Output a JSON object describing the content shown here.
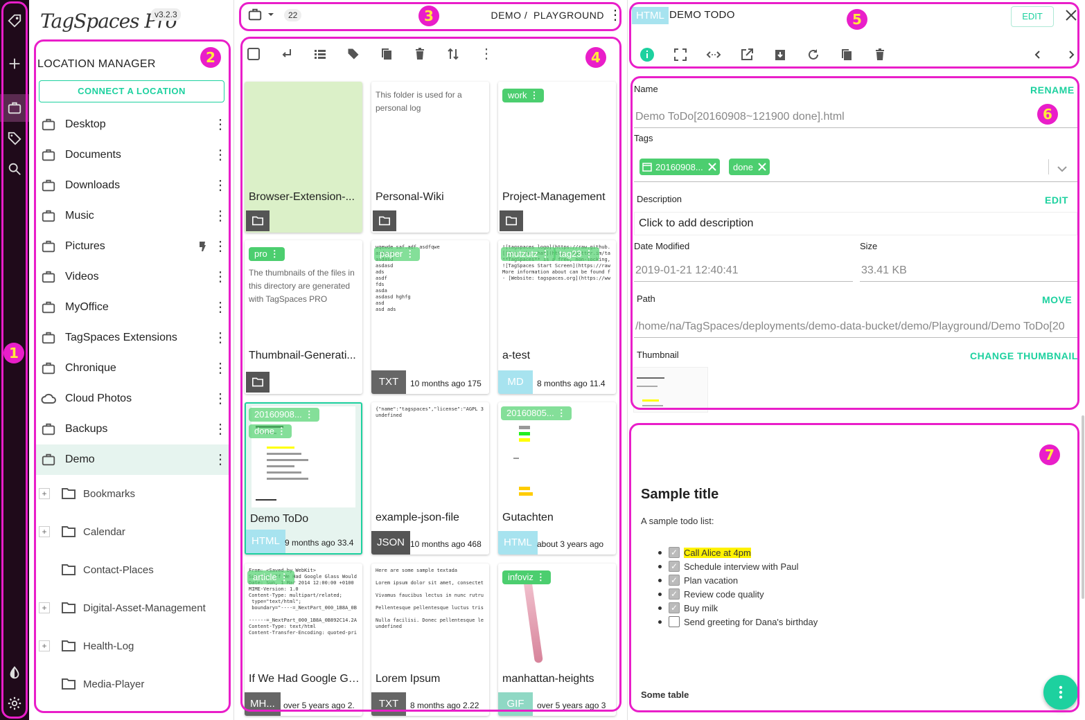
{
  "app": {
    "logo": "TagSpaces Pro",
    "version": "v3.2.3"
  },
  "leftbar": {
    "icons": [
      "tagspaces-logo-icon",
      "add-icon",
      "locations-icon",
      "tags-icon",
      "search-icon",
      "theme-icon",
      "settings-icon"
    ]
  },
  "location_manager": {
    "title": "LOCATION MANAGER",
    "connect_label": "CONNECT A LOCATION",
    "locations": [
      {
        "label": "Desktop"
      },
      {
        "label": "Documents"
      },
      {
        "label": "Downloads"
      },
      {
        "label": "Music"
      },
      {
        "label": "Pictures"
      },
      {
        "label": "Videos"
      },
      {
        "label": "MyOffice"
      },
      {
        "label": "TagSpaces Extensions"
      },
      {
        "label": "Chronique"
      },
      {
        "label": "Cloud Photos"
      },
      {
        "label": "Backups"
      },
      {
        "label": "Demo"
      }
    ],
    "tree": [
      {
        "label": "Bookmarks",
        "expandable": true
      },
      {
        "label": "Calendar",
        "expandable": true
      },
      {
        "label": "Contact-Places",
        "expandable": false
      },
      {
        "label": "Digital-Asset-Management",
        "expandable": true
      },
      {
        "label": "Health-Log",
        "expandable": true
      },
      {
        "label": "Media-Player",
        "expandable": false
      }
    ]
  },
  "topbar": {
    "count": "22",
    "breadcrumb": "DEMO /  PLAYGROUND"
  },
  "grid": {
    "cards": [
      {
        "name": "Browser-Extension-...",
        "type": "folder"
      },
      {
        "name": "Personal-Wiki",
        "type": "folder",
        "desc": "This folder is used for a personal log"
      },
      {
        "name": "Project-Management",
        "type": "folder",
        "tag": "work"
      },
      {
        "name": "Thumbnail-Generati...",
        "type": "folder",
        "tag": "pro",
        "desc": "The thumbnails of the files in this directory are generated with TagSpaces PRO"
      },
      {
        "name": "",
        "ext": "TXT",
        "meta": "10 months ago 175",
        "tag": "paper"
      },
      {
        "name": "a-test",
        "ext": "MD",
        "meta": "8 months ago 11.4",
        "tags": [
          "mutzutz",
          "tag23"
        ]
      },
      {
        "name": "Demo ToDo",
        "ext": "HTML",
        "meta": "9 months ago 33.4",
        "tags": [
          "20160908...",
          "done"
        ]
      },
      {
        "name": "example-json-file",
        "ext": "JSON",
        "meta": "10 months ago 468"
      },
      {
        "name": "Gutachten",
        "ext": "HTML",
        "meta": "about 3 years ago",
        "tag": "20160805..."
      },
      {
        "name": "If We Had Google Gl...",
        "ext": "MH...",
        "meta": "over 5 years ago 2.",
        "tag": "article"
      },
      {
        "name": "Lorem Ipsum",
        "ext": "TXT",
        "meta": "8 months ago 2.22"
      },
      {
        "name": "manhattan-heights",
        "ext": "GIF",
        "meta": "over 5 years ago 3",
        "tag": "infoviz"
      }
    ],
    "thumb_texts": {
      "card5": "wqewde saf.adf asdfqwe\nasdasd\nasdasd\nasdasd\nads\nasdf\nfds\nasda\nasdasd hghfg\nasd\nasd ads",
      "card6": "![tagspaces logo](https://raw.github.com/tags\n[[Join the chat](https://gitter.im/tagspaces/t\n**TagSpaces** is a free, non-locking, open so\n![TagSpaces Start Screen](https://raw.githubu\nMore information about can be found from th\n- [Website: tagspaces.org](https://www.tagspa",
      "card8": "{\"name\":\"tagspaces\",\"license\":\"AGPL 3.0\",\"a\nundefined",
      "card10": "From: <Saved by WebKit>\nSubject: If We Had Google Glass Wouldn't We\nDate: Sun, 1 Mar 2014 12:00:00 +0100\nMIME-Version: 1.0\nContent-Type: multipart/related;\n type=\"text/html\";\n boundary=\"----=_NextPart_000_1B8A_0B89\n\n------=_NextPart_000_1B8A_0B892C14.2A55\nContent-Type: text/html\nContent-Transfer-Encoding: quoted-printable",
      "card11": "Here are some sample textada\n\nLorem ipsum dolor sit amet, consectetur adip\n\nVivamus faucibus lectus in nunc rutrum, ac fa\n\nPellentesque pellentesque luctus tristique. Su\n\nNulla facilisi. Donec pellentesque leo sit amet\nundefined"
    }
  },
  "entry": {
    "ext": "HTML",
    "title": "DEMO TODO",
    "edit_label": "EDIT",
    "fields": {
      "name_label": "Name",
      "rename": "RENAME",
      "name_value": "Demo ToDo[20160908~121900 done].html",
      "tags_label": "Tags",
      "tags": [
        "20160908...",
        "done"
      ],
      "desc_label": "Description",
      "desc_edit": "EDIT",
      "desc_placeholder": "Click to add description",
      "date_label": "Date Modified",
      "date_value": "2019-01-21 12:40:41",
      "size_label": "Size",
      "size_value": "33.41 KB",
      "path_label": "Path",
      "move": "MOVE",
      "path_value": "/home/na/TagSpaces/deployments/demo-data-bucket/demo/Playground/Demo ToDo[20",
      "thumb_label": "Thumbnail",
      "change_thumb": "CHANGE THUMBNAIL"
    }
  },
  "preview": {
    "title": "Sample title",
    "subtitle": "A sample todo list:",
    "items": [
      {
        "text": "Call Alice at 4pm",
        "checked": true,
        "highlight": true
      },
      {
        "text": "Schedule interview with Paul",
        "checked": true
      },
      {
        "text": "Plan vacation",
        "checked": true
      },
      {
        "text": "Review code quality",
        "checked": true
      },
      {
        "text": "Buy milk",
        "checked": true
      },
      {
        "text": "Send greeting for Dana's birthday",
        "checked": false
      }
    ],
    "table_title": "Some table"
  },
  "annotations": [
    "1",
    "2",
    "3",
    "4",
    "5",
    "6",
    "7"
  ],
  "colors": {
    "accent": "#1dd19f",
    "highlight": "#e91ec9",
    "tag": "#4cce6f",
    "sidebar": "#1f0a1a"
  }
}
